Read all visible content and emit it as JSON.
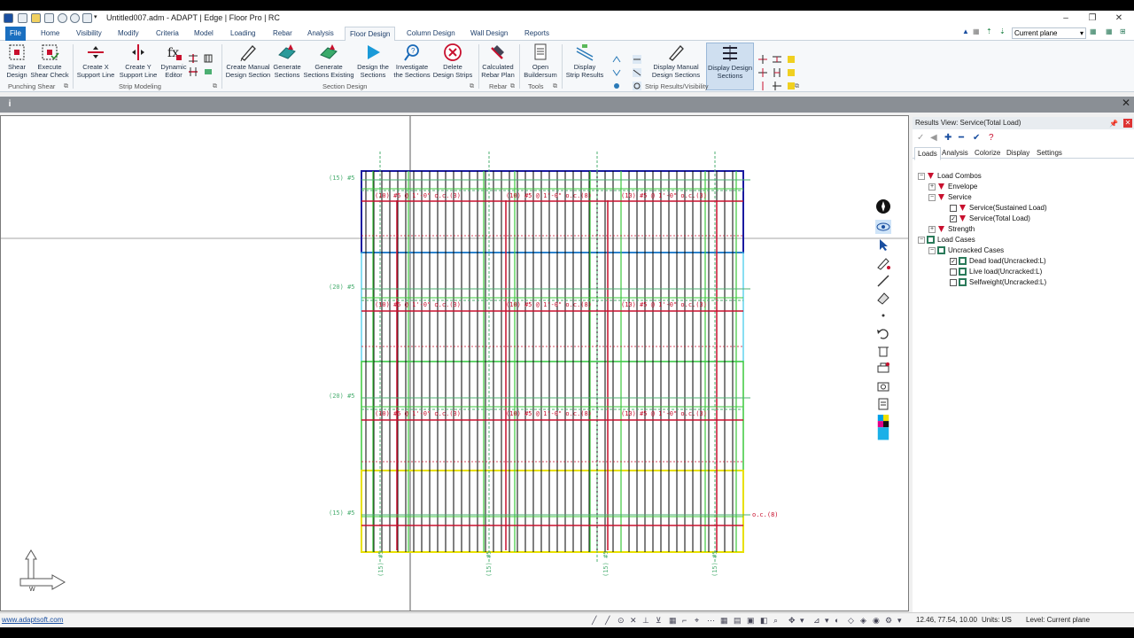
{
  "window": {
    "title": "Untitled007.adm - ADAPT | Edge | Floor Pro | RC",
    "minimize": "–",
    "maximize": "❐",
    "close": "✕"
  },
  "menu": {
    "tabs": [
      "File",
      "Home",
      "Visibility",
      "Modify",
      "Criteria",
      "Model",
      "Loading",
      "Rebar",
      "Analysis",
      "Floor Design",
      "Column Design",
      "Wall Design",
      "Reports"
    ],
    "active": "Floor Design",
    "plane_value": "Current plane"
  },
  "ribbon": {
    "buttons": {
      "shear_design": "Shear\nDesign",
      "execute_shear_check": "Execute\nShear Check",
      "create_x_support": "Create X\nSupport Line",
      "create_y_support": "Create Y\nSupport Line",
      "dynamic_editor": "Dynamic\nEditor",
      "create_manual_section": "Create Manual\nDesign Section",
      "generate_sections": "Generate\nSections",
      "generate_sections_existing": "Generate\nSections Existing",
      "design_sections": "Design the\nSections",
      "investigate_sections": "Investigate\nthe Sections",
      "delete_design_strips": "Delete\nDesign Strips",
      "calculated_rebar_plan": "Calculated\nRebar Plan",
      "open_buildersum": "Open\nBuildersum",
      "display_strip_results": "Display\nStrip Results",
      "display_manual_sections": "Display Manual\nDesign Sections",
      "display_design_sections": "Display Design\nSections"
    },
    "groups": {
      "punching_shear": "Punching Shear",
      "strip_modeling": "Strip Modeling",
      "section_design": "Section Design",
      "rebar": "Rebar",
      "tools": "Tools",
      "strip_results": "Strip Results/Visibility"
    }
  },
  "info": {
    "icon": "i",
    "close": "✕"
  },
  "drawing": {
    "colors": {
      "blue": "#1a1aa0",
      "cyan": "#3ac8e8",
      "green": "#3cc83c",
      "yellow": "#e8e000",
      "red": "#c8102e",
      "rebar_green": "#4caf72",
      "black": "#000000"
    },
    "row_labels": [
      "(15) #5",
      "(20) #5",
      "(20) #5",
      "(15) #5"
    ],
    "rebar_top_label": "(10) #5 @ 1'-0\" o.c.(3)",
    "rebar_top_label_b": "(10) #5 @ 1'-0\" o.c.(8)",
    "trailing_label": "o.c.(8)",
    "vertical_labels": [
      "(15) #5",
      "(15) #5",
      "(15) #5",
      "(15) #5"
    ]
  },
  "panel": {
    "title": "Results View: Service(Total Load)",
    "tabs": [
      "Loads",
      "Analysis",
      "Colorize",
      "Display",
      "Settings"
    ],
    "active_tab": "Loads",
    "tree": {
      "load_combos": "Load Combos",
      "envelope": "Envelope",
      "service": "Service",
      "service_sustained": "Service(Sustained Load)",
      "service_total": "Service(Total Load)",
      "strength": "Strength",
      "load_cases": "Load Cases",
      "uncracked_cases": "Uncracked Cases",
      "dead_load": "Dead load(Uncracked:L)",
      "live_load": "Live load(Uncracked:L)",
      "selfweight": "Selfweight(Uncracked:L)"
    },
    "checked": {
      "service_sustained": false,
      "service_total": true,
      "dead_load": true,
      "live_load": false,
      "selfweight": false
    }
  },
  "status": {
    "link": "www.adaptsoft.com",
    "coords": "12.46, 77.54, 10.00",
    "units": "Units: US",
    "level": "Level: Current plane"
  }
}
